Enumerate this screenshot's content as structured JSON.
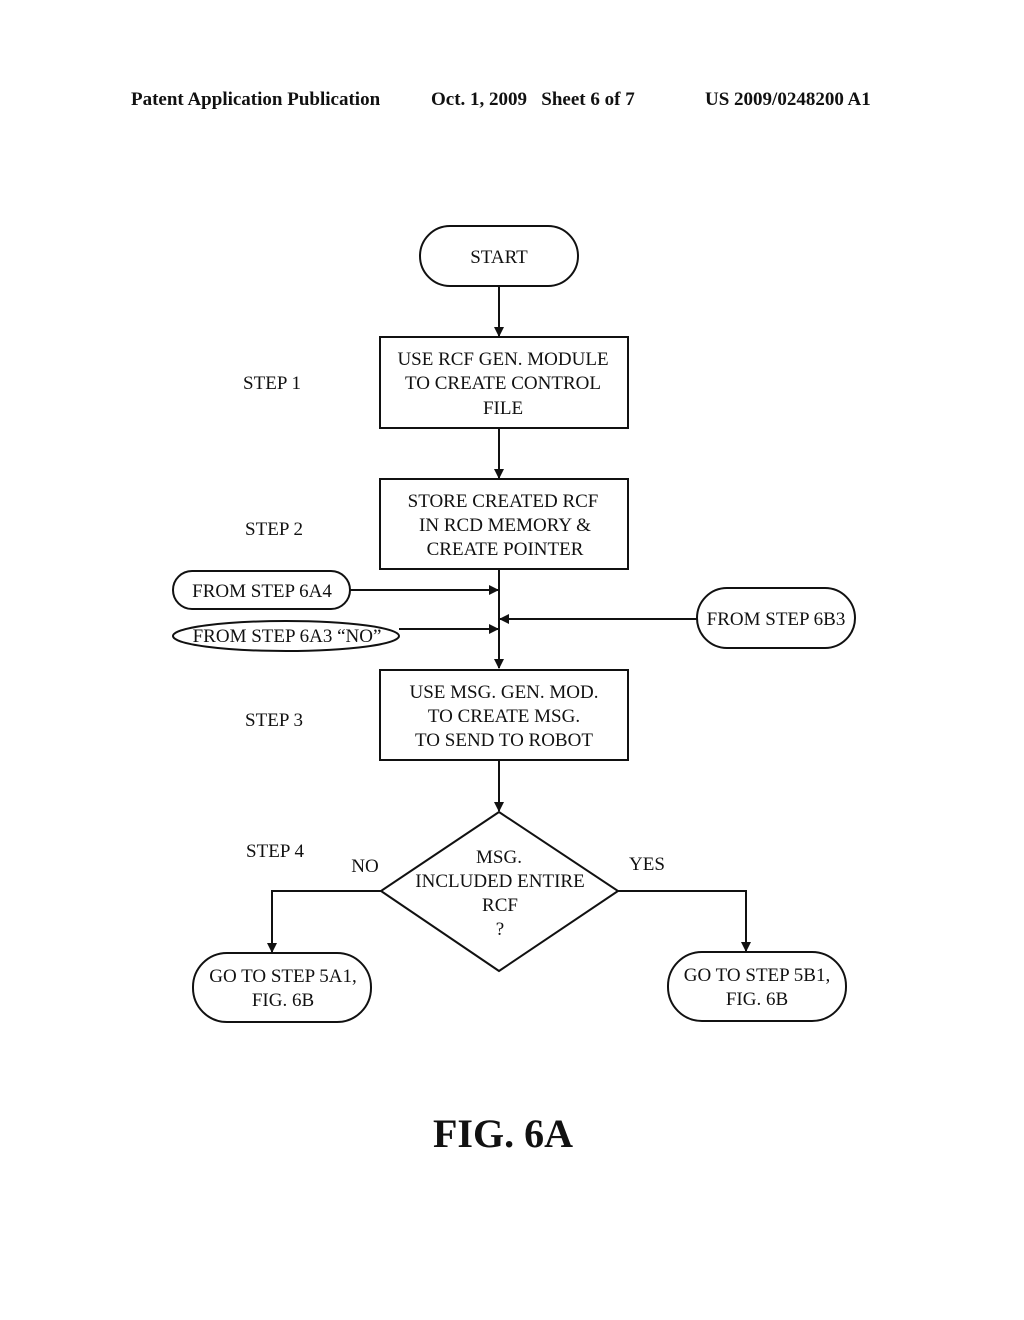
{
  "header": {
    "publication": "Patent Application Publication",
    "date_sheet": "Oct. 1, 2009   Sheet 6 of 7",
    "number": "US 2009/0248200 A1"
  },
  "flowchart": {
    "start": "START",
    "steps": [
      {
        "label": "STEP 1",
        "lines": [
          "USE RCF GEN. MODULE",
          "TO CREATE CONTROL",
          "FILE"
        ]
      },
      {
        "label": "STEP 2",
        "lines": [
          "STORE CREATED RCF",
          "IN RCD MEMORY &",
          "CREATE POINTER"
        ]
      },
      {
        "label": "STEP 3",
        "lines": [
          "USE MSG. GEN. MOD.",
          "TO CREATE MSG.",
          "TO SEND TO ROBOT"
        ]
      },
      {
        "label": "STEP 4",
        "lines": [
          "MSG.",
          "INCLUDED ENTIRE",
          "RCF",
          "?"
        ]
      }
    ],
    "connectors": {
      "from_6a4": "FROM STEP 6A4",
      "from_6a3": "FROM STEP 6A3 “NO”",
      "from_6b3": "FROM STEP 6B3"
    },
    "branches": {
      "no_label": "NO",
      "yes_label": "YES",
      "no_target": [
        "GO TO STEP 5A1,",
        "FIG. 6B"
      ],
      "yes_target": [
        "GO TO STEP 5B1,",
        "FIG. 6B"
      ]
    },
    "figure_label": "FIG. 6A"
  }
}
